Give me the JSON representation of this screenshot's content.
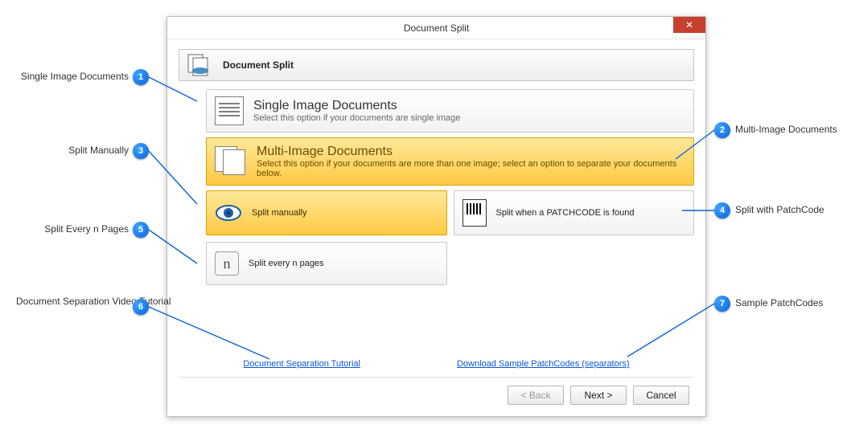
{
  "window": {
    "title": "Document Split"
  },
  "header": {
    "title": "Document Split"
  },
  "options": {
    "single": {
      "title": "Single Image Documents",
      "desc": "Select this option if your documents are single image"
    },
    "multi": {
      "title": "Multi-Image Documents",
      "desc": "Select this option if your documents are more than one image; select an option to separate your documents below."
    }
  },
  "sub": {
    "manual": "Split manually",
    "patchcode": "Split when a PATCHCODE is found",
    "everyn": "Split every n pages"
  },
  "links": {
    "tutorial": "Document Separation Tutorial",
    "samples": "Download Sample PatchCodes (separators)"
  },
  "footer": {
    "back": "< Back",
    "next": "Next >",
    "cancel": "Cancel"
  },
  "callouts": {
    "c1": {
      "n": "1",
      "label": "Single Image Documents"
    },
    "c2": {
      "n": "2",
      "label": "Multi-Image Documents"
    },
    "c3": {
      "n": "3",
      "label": "Split Manually"
    },
    "c4": {
      "n": "4",
      "label": "Split with PatchCode"
    },
    "c5": {
      "n": "5",
      "label": "Split Every n Pages"
    },
    "c6": {
      "n": "6",
      "label": "Document Separation Video Tutorial"
    },
    "c7": {
      "n": "7",
      "label": "Sample PatchCodes"
    }
  },
  "icons": {
    "n_glyph": "n"
  }
}
